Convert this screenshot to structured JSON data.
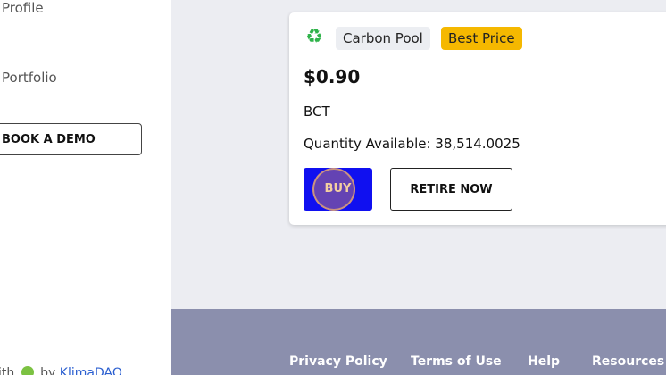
{
  "sidebar": {
    "nav": {
      "profile": "Profile",
      "portfolio": "Portfolio"
    },
    "demo_button": "BOOK A DEMO",
    "powered_prefix": "ith",
    "powered_mid": "by",
    "powered_link": "KlimaDAO"
  },
  "card": {
    "icon": "recycle-icon",
    "pool_chip": "Carbon Pool",
    "best_chip": "Best Price",
    "price": "$0.90",
    "token": "BCT",
    "quantity": "Quantity Available: 38,514.0025",
    "buy_label": "BUY",
    "retire_label": "RETIRE NOW"
  },
  "footer": {
    "links": [
      "Privacy Policy",
      "Terms of Use",
      "Help",
      "Resources"
    ]
  },
  "colors": {
    "buy_button": "#1010f0",
    "best_price_chip": "#f5b800",
    "footer_bg": "#8b8fad",
    "recycle_icon": "#2fb34a"
  }
}
